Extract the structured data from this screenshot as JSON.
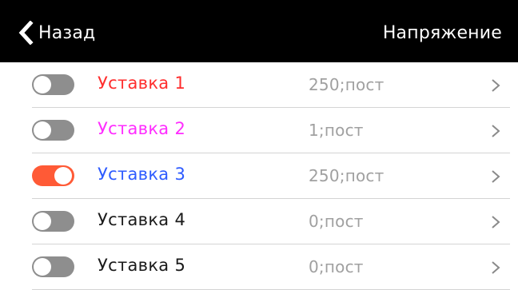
{
  "header": {
    "back_label": "Назад",
    "title": "Напряжение",
    "back_icon": "chevron-left-icon"
  },
  "rows": [
    {
      "label": "Уставка 1",
      "value": "250;пост",
      "enabled": false,
      "label_color": "#ff2d2d"
    },
    {
      "label": "Уставка 2",
      "value": "1;пост",
      "enabled": false,
      "label_color": "#ff2cff"
    },
    {
      "label": "Уставка 3",
      "value": "250;пост",
      "enabled": true,
      "label_color": "#2e5bff"
    },
    {
      "label": "Уставка 4",
      "value": "0;пост",
      "enabled": false,
      "label_color": "#1a1a1a"
    },
    {
      "label": "Уставка 5",
      "value": "0;пост",
      "enabled": false,
      "label_color": "#1a1a1a"
    }
  ],
  "colors": {
    "toggle_on": "#ff5a36",
    "toggle_off": "#8e8e8e",
    "value_text": "#a0a0a0",
    "chevron": "#8a8a8a"
  },
  "row_icon": "chevron-right-icon"
}
